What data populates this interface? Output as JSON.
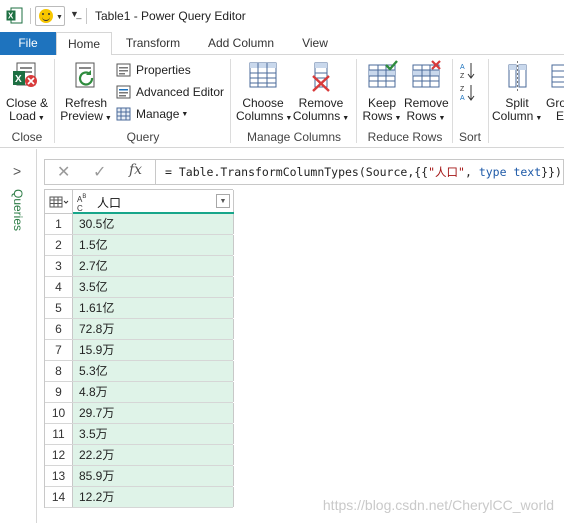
{
  "window": {
    "title": "Table1 - Power Query Editor"
  },
  "tabs": [
    "File",
    "Home",
    "Transform",
    "Add Column",
    "View"
  ],
  "ribbon": {
    "close_group": {
      "label": "Close",
      "close_load": [
        "Close &",
        "Load"
      ]
    },
    "query_group": {
      "label": "Query",
      "refresh_preview": [
        "Refresh",
        "Preview"
      ],
      "properties": "Properties",
      "advanced_editor": "Advanced Editor",
      "manage": "Manage"
    },
    "manage_columns_group": {
      "label": "Manage Columns",
      "choose_columns": [
        "Choose",
        "Columns"
      ],
      "remove_columns": [
        "Remove",
        "Columns"
      ]
    },
    "reduce_rows_group": {
      "label": "Reduce Rows",
      "keep_rows": [
        "Keep",
        "Rows"
      ],
      "remove_rows": [
        "Remove",
        "Rows"
      ]
    },
    "sort_group": {
      "label": "Sort"
    },
    "split_column": [
      "Split",
      "Column"
    ],
    "partial_next": [
      "Gro",
      "E"
    ]
  },
  "queries_pane": {
    "label": "Queries"
  },
  "formula_bar": {
    "fx": "fx",
    "formula_prefix": "= Table.TransformColumnTypes(Source,{{",
    "formula_string": "\"人口\"",
    "formula_mid": ", ",
    "formula_type": "type text",
    "formula_suffix": "}})"
  },
  "grid": {
    "column_type": "ABC",
    "column_name": "人口",
    "rows": [
      {
        "n": "1",
        "v": "30.5亿"
      },
      {
        "n": "2",
        "v": "1.5亿"
      },
      {
        "n": "3",
        "v": "2.7亿"
      },
      {
        "n": "4",
        "v": "3.5亿"
      },
      {
        "n": "5",
        "v": "1.61亿"
      },
      {
        "n": "6",
        "v": "72.8万"
      },
      {
        "n": "7",
        "v": "15.9万"
      },
      {
        "n": "8",
        "v": "5.3亿"
      },
      {
        "n": "9",
        "v": "4.8万"
      },
      {
        "n": "10",
        "v": "29.7万"
      },
      {
        "n": "11",
        "v": "3.5万"
      },
      {
        "n": "12",
        "v": "22.2万"
      },
      {
        "n": "13",
        "v": "85.9万"
      },
      {
        "n": "14",
        "v": "12.2万"
      }
    ]
  },
  "watermark": "https://blog.csdn.net/CherylCC_world",
  "colors": {
    "accent": "#1e73be",
    "cell_bg": "#dff3e8",
    "quality_bar": "#17a68a",
    "queries_label": "#2e7d47"
  }
}
